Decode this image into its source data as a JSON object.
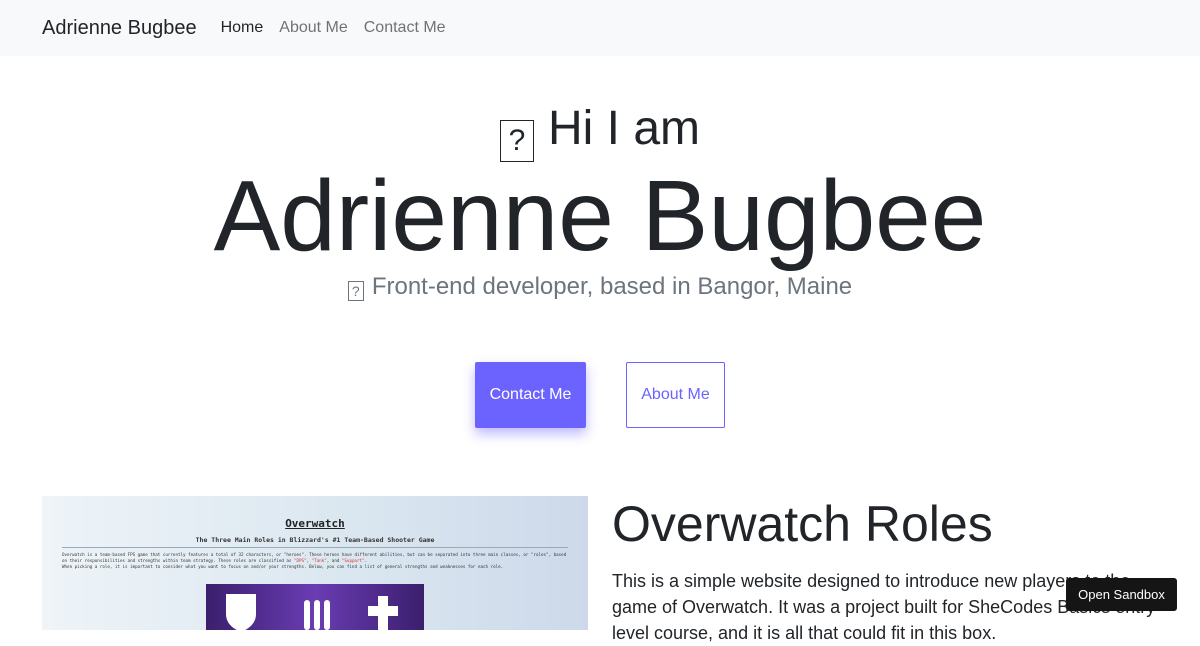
{
  "nav": {
    "brand": "Adrienne Bugbee",
    "links": [
      {
        "label": "Home",
        "active": true
      },
      {
        "label": "About Me",
        "active": false
      },
      {
        "label": "Contact Me",
        "active": false
      }
    ]
  },
  "hero": {
    "greeting_icon": "?",
    "greeting": "Hi I am",
    "name": "Adrienne Bugbee",
    "tagline_icon": "?",
    "tagline": "Front-end developer, based in Bangor, Maine"
  },
  "actions": {
    "primary": "Contact Me",
    "secondary": "About Me"
  },
  "project": {
    "image": {
      "title": "Overwatch",
      "subtitle": "The Three Main Roles in Blizzard's #1 Team-Based Shooter Game",
      "para_1": "Overwatch is a team-based FPS game that currently features a total of 32 characters, or \"heroes\". These heroes have different abilities, but can be separated into three main classes, or \"roles\", based on their responsibilities and strengths within team strategy. These roles are classified as",
      "role_1": "\"DPS\"",
      "role_2": "\"Tank\"",
      "role_3": "\"Support\"",
      "para_2": "When picking a role, it is important to consider what you want to focus on and/or your strengths. Below, you can find a list of general strengths and weaknesses for each role."
    },
    "title": "Overwatch Roles",
    "description": "This is a simple website designed to introduce new players to the game of Overwatch. It was a project built for SheCodes Basics entry level course, and it is all that could fit in this box."
  },
  "sandbox": {
    "label": "Open Sandbox"
  },
  "colors": {
    "accent": "#6c63ff",
    "navbar_bg": "#f8f9fa"
  }
}
